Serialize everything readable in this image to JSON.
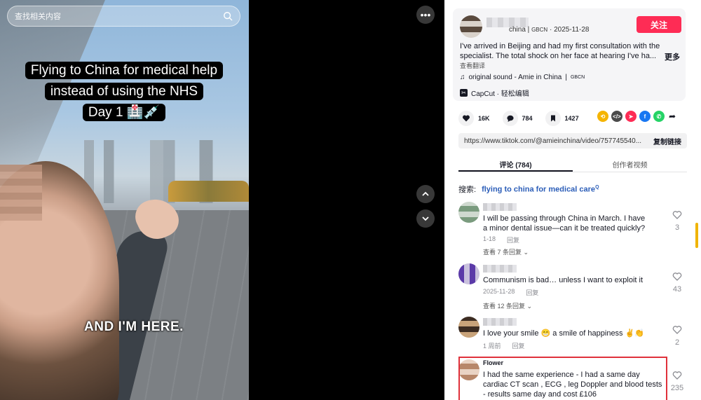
{
  "search": {
    "placeholder": "查找相关内容"
  },
  "video": {
    "caption_line1": "Flying to China for medical help",
    "caption_line2": "instead of using the NHS",
    "caption_line3": "Day 1 🏥💉",
    "subtitle": "AND I'M HERE."
  },
  "post": {
    "author_suffix": "china",
    "author_tag": "GBCN",
    "date": "2025-11-28",
    "follow_label": "关注",
    "description": "I've arrived in Beijing and had my first consultation with the specialist. The total shock on her face at hearing I've ha...",
    "more_label": "更多",
    "translate_label": "查看翻译",
    "sound": "original sound - Amie in China",
    "sound_tag": "GBCN",
    "capcut": "CapCut · 轻松编辑"
  },
  "actions": {
    "likes": "16K",
    "comments": "784",
    "saves": "1427"
  },
  "share_colors": {
    "icon1": "#f5b400",
    "icon2": "#4a4a4a",
    "icon3": "#fe2c55",
    "icon4": "#1877f2",
    "icon5": "#25d366"
  },
  "link": {
    "url": "https://www.tiktok.com/@amieinchina/video/757745540...",
    "copy_label": "复制链接"
  },
  "tabs": {
    "comments": "评论 (784)",
    "creator": "创作者视频"
  },
  "search_line": {
    "label": "搜索:",
    "keyword": "flying to china for medical care"
  },
  "comments": [
    {
      "text": "I will be passing through China in March. I have a minor dental issue—can it be treated quickly?",
      "date": "1-18",
      "reply": "回复",
      "view_replies": "查看 7 条回复",
      "likes": "3"
    },
    {
      "text": "Communism is bad… unless I want to exploit it",
      "date": "2025-11-28",
      "reply": "回复",
      "view_replies": "查看 12 条回复",
      "likes": "43"
    },
    {
      "text": "I love your smile 😁 a smile of happiness ✌️👏",
      "date": "1 周前",
      "reply": "回复",
      "likes": "2"
    },
    {
      "username": "Flower",
      "text": "I had the same experience - I had a same day cardiac CT scan , ECG , leg Doppler and blood tests - results same day and cost £106",
      "likes": "235"
    }
  ],
  "colors": {
    "follow": "#fe2c55",
    "highlight_box": "#e0313b",
    "link_blue": "#2b5db8"
  }
}
